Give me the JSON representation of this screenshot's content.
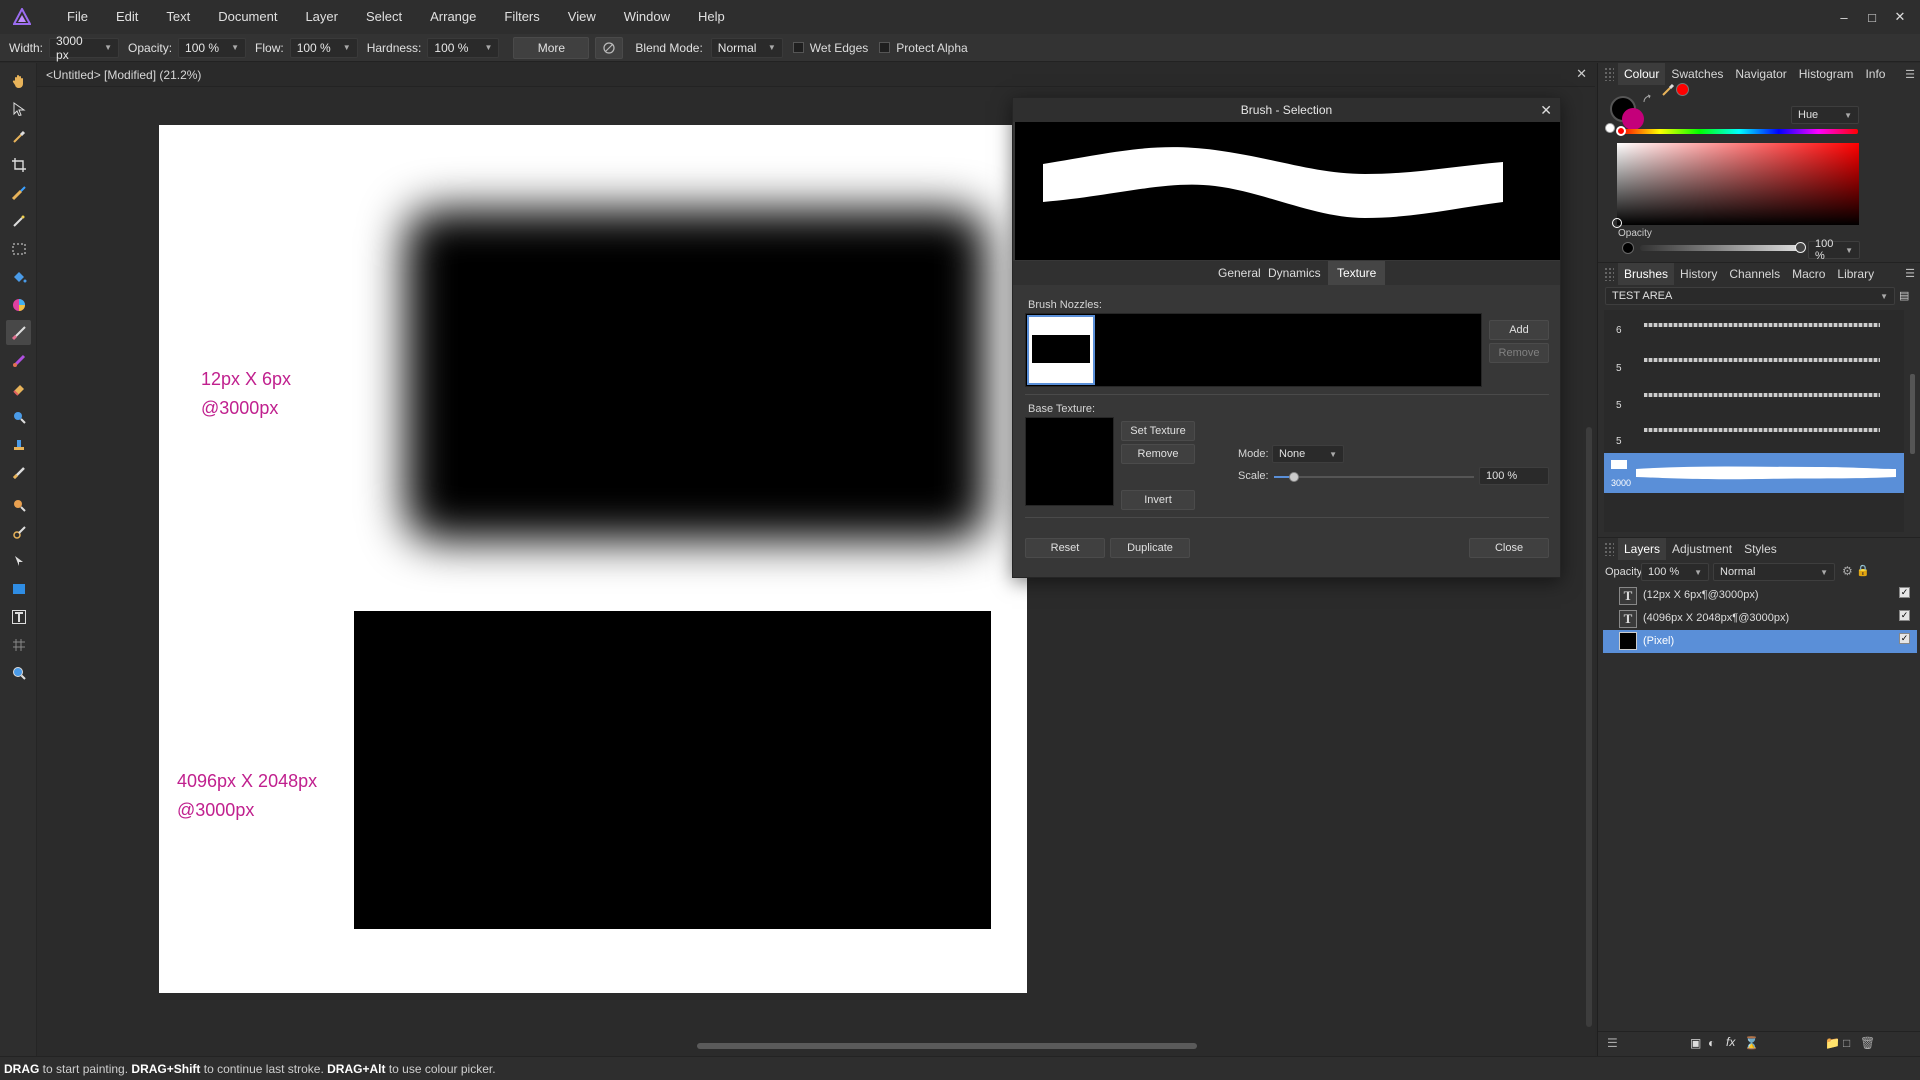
{
  "menubar": {
    "items": [
      "File",
      "Edit",
      "Text",
      "Document",
      "Layer",
      "Select",
      "Arrange",
      "Filters",
      "View",
      "Window",
      "Help"
    ],
    "window_controls": [
      "–",
      "□",
      "✕"
    ]
  },
  "context_toolbar": {
    "width_label": "Width:",
    "width_value": "3000 px",
    "opacity_label": "Opacity:",
    "opacity_value": "100 %",
    "flow_label": "Flow:",
    "flow_value": "100 %",
    "hardness_label": "Hardness:",
    "hardness_value": "100 %",
    "more_label": "More",
    "blend_mode_label": "Blend Mode:",
    "blend_mode_value": "Normal",
    "wet_edges_label": "Wet Edges",
    "protect_alpha_label": "Protect Alpha"
  },
  "document": {
    "title": "<Untitled> [Modified] (21.2%)",
    "close": "✕",
    "text_top_line1": "12px X 6px",
    "text_top_line2": "@3000px",
    "text_bottom_line1": "4096px X 2048px",
    "text_bottom_line2": "@3000px",
    "text_color": "#c0208e"
  },
  "brush_dialog": {
    "title": "Brush - Selection",
    "close": "✕",
    "tabs": [
      "General",
      "Dynamics",
      "Texture"
    ],
    "selected_tab": "Texture",
    "nozzles_label": "Brush Nozzles:",
    "add_label": "Add",
    "remove_label": "Remove",
    "base_texture_label": "Base Texture:",
    "set_texture_label": "Set Texture",
    "texture_remove_label": "Remove",
    "invert_label": "Invert",
    "mode_label": "Mode:",
    "mode_value": "None",
    "scale_label": "Scale:",
    "scale_value": "100 %",
    "scale_fraction": 0.1,
    "reset_label": "Reset",
    "duplicate_label": "Duplicate",
    "close_label": "Close"
  },
  "colour_panel": {
    "tabs": [
      "Colour",
      "Swatches",
      "Navigator",
      "Histogram",
      "Info"
    ],
    "model_value": "Hue",
    "opacity_label": "Opacity",
    "opacity_value": "100 %",
    "primary_color": "#000000",
    "secondary_color": "#c4007a",
    "hue_color": "#ff0000"
  },
  "brushes_panel": {
    "tabs": [
      "Brushes",
      "History",
      "Channels",
      "Macro",
      "Library"
    ],
    "category": "TEST AREA",
    "brush_sizes": [
      "6",
      "5",
      "5",
      "5"
    ],
    "selected_brush_size": "3000"
  },
  "layers_panel": {
    "tabs": [
      "Layers",
      "Adjustment",
      "Styles"
    ],
    "opacity_label": "Opacity:",
    "opacity_value": "100 %",
    "blend_value": "Normal",
    "layers": [
      {
        "name": "(12px X 6px¶@3000px)",
        "selected": false
      },
      {
        "name": "(4096px X 2048px¶@3000px)",
        "selected": false
      },
      {
        "name": "(Pixel)",
        "selected": true
      }
    ]
  },
  "status": {
    "k1": "DRAG",
    "t1": " to start painting. ",
    "k2": "DRAG+Shift",
    "t2": " to continue last stroke. ",
    "k3": "DRAG+Alt",
    "t3": " to use colour picker."
  }
}
